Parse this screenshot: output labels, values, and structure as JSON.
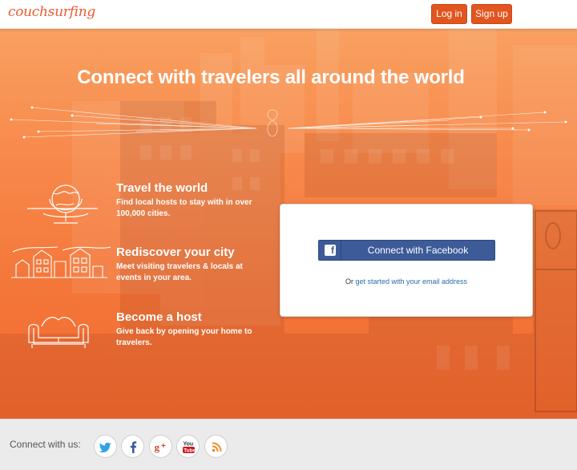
{
  "header": {
    "logo_text": "couchsurfing",
    "login_label": "Log in",
    "signup_label": "Sign up"
  },
  "hero": {
    "headline": "Connect with travelers all around the world",
    "features": [
      {
        "title": "Travel the world",
        "description": "Find local hosts to stay with in over 100,000 cities.",
        "icon": "globe-icon"
      },
      {
        "title": "Rediscover your city",
        "description": "Meet visiting travelers & locals at events in your area.",
        "icon": "city-icon"
      },
      {
        "title": "Become a host",
        "description": "Give back by opening your home to travelers.",
        "icon": "couch-icon"
      }
    ]
  },
  "signup_card": {
    "facebook_label": "Connect with Facebook",
    "email_prefix": "Or",
    "email_link": "get started with your email address"
  },
  "footer": {
    "connect_label": "Connect with us:",
    "social": [
      "twitter-icon",
      "facebook-icon",
      "google-plus-icon",
      "youtube-icon",
      "rss-icon"
    ]
  },
  "colors": {
    "accent": "#e2551f",
    "hero_orange": "#f4773a",
    "facebook_blue": "#3d5b99",
    "link_blue": "#2a6db0"
  }
}
